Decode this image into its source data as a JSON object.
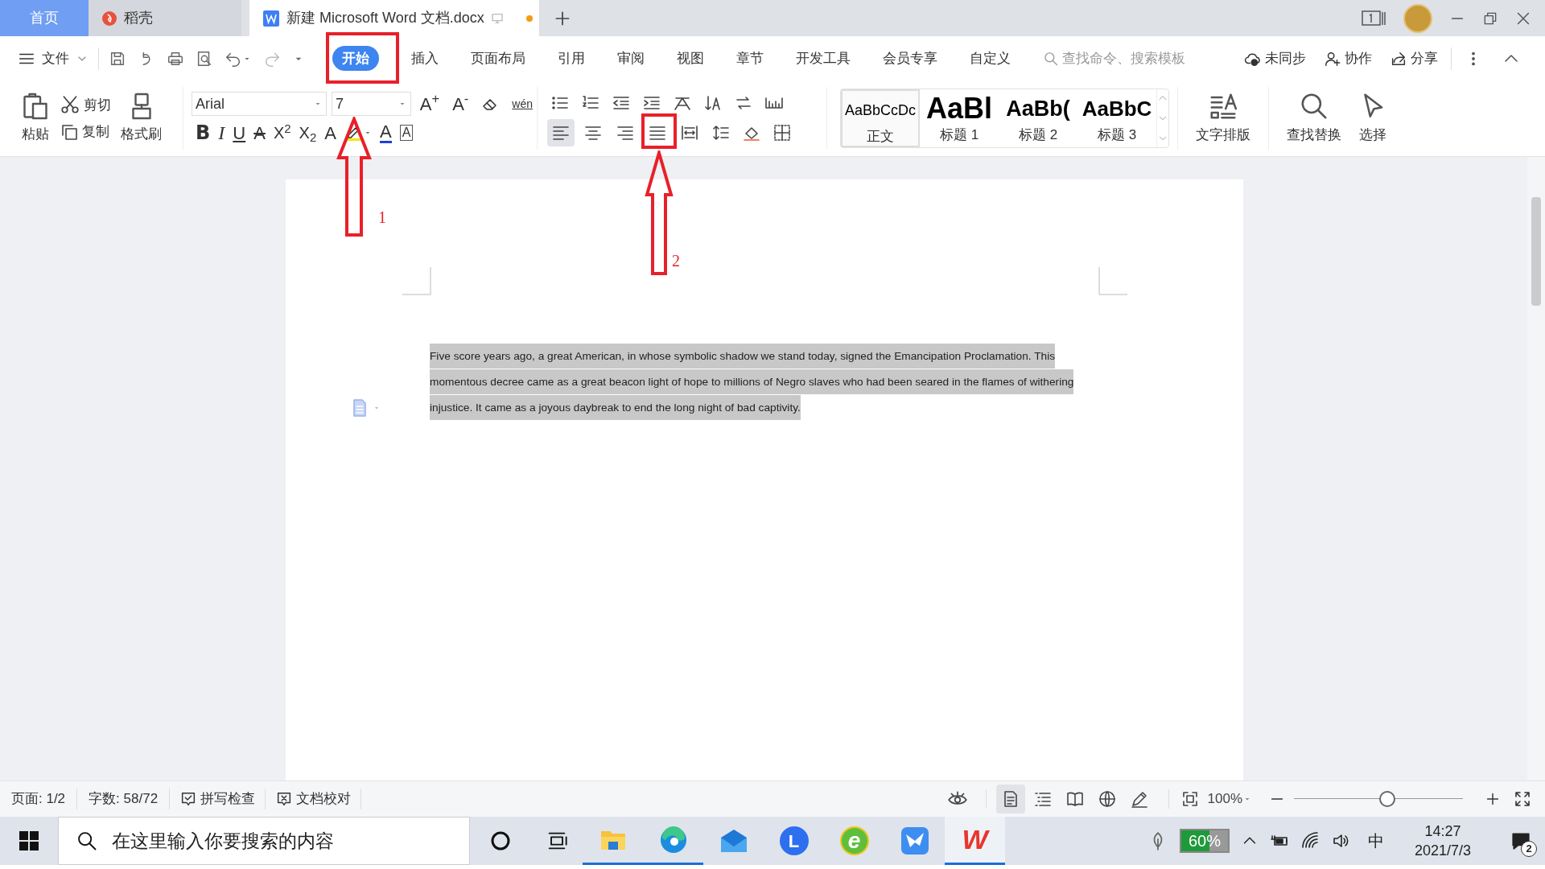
{
  "tabs": [
    {
      "label": "首页",
      "kind": "home",
      "selected": false,
      "unsaved": false
    },
    {
      "label": "稻壳",
      "kind": "docer",
      "selected": false,
      "unsaved": false
    },
    {
      "label": "新建 Microsoft Word 文档.docx",
      "kind": "document",
      "selected": true,
      "unsaved": true
    }
  ],
  "menu": {
    "file": "文件",
    "items": [
      {
        "label": "开始",
        "selected": true
      },
      {
        "label": "插入",
        "selected": false
      },
      {
        "label": "页面布局",
        "selected": false
      },
      {
        "label": "引用",
        "selected": false
      },
      {
        "label": "审阅",
        "selected": false
      },
      {
        "label": "视图",
        "selected": false
      },
      {
        "label": "章节",
        "selected": false
      },
      {
        "label": "开发工具",
        "selected": false
      },
      {
        "label": "会员专享",
        "selected": false
      },
      {
        "label": "自定义",
        "selected": false
      }
    ],
    "search": {
      "placeholder": "查找命令、搜索模板"
    },
    "sync": "未同步",
    "collaborate": "协作",
    "share": "分享"
  },
  "ribbon": {
    "paste": "粘贴",
    "cut": "剪切",
    "copy": "复制",
    "format_painter": "格式刷",
    "font_name": "Arial",
    "font_size": "7",
    "font_buttons_top": [
      {
        "kind": "grow",
        "glyph": "A$^{+}$"
      },
      {
        "kind": "shrink",
        "glyph": "A$^{-}$"
      },
      {
        "kind": "pinyin",
        "glyph": "wén"
      }
    ],
    "font_buttons": [
      {
        "kind": "bold",
        "glyph": "B"
      },
      {
        "kind": "italic",
        "glyph": "I"
      },
      {
        "kind": "underline",
        "glyph": "U"
      },
      {
        "kind": "strike",
        "glyph": "A"
      },
      {
        "kind": "superscript",
        "glyph": "X$^{2}$"
      },
      {
        "kind": "subscript",
        "glyph": "X$_{2}$"
      },
      {
        "kind": "effect",
        "glyph": "A"
      },
      {
        "kind": "highlight"
      },
      {
        "kind": "color",
        "glyph": "A"
      },
      {
        "kind": "border",
        "glyph": "A"
      }
    ],
    "alignments": [
      {
        "kind": "left",
        "selected": true
      },
      {
        "kind": "center",
        "selected": false
      },
      {
        "kind": "right",
        "selected": false
      },
      {
        "kind": "justify",
        "selected": false
      },
      {
        "kind": "distributed",
        "selected": false
      }
    ],
    "styles": [
      {
        "preview": "AaBbCcDc",
        "label": "正文",
        "kind": "body",
        "selected": true
      },
      {
        "preview": "AaBl",
        "label": "标题 1",
        "kind": "h1",
        "selected": false
      },
      {
        "preview": "AaBb(",
        "label": "标题 2",
        "kind": "h2",
        "selected": false
      },
      {
        "preview": "AaBbC",
        "label": "标题 3",
        "kind": "h3",
        "selected": false
      }
    ],
    "text_layout": "文字排版",
    "find_replace": "查找替换",
    "select": "选择"
  },
  "document": {
    "paragraph": "Five score years ago, a great American, in whose symbolic shadow we stand today, signed the Emancipation Proclamation. This momentous decree came as a great beacon light of hope to millions of Negro slaves who had been seared in the flames of withering injustice. It came as a joyous daybreak to end the long night of bad captivity.",
    "selected": true
  },
  "annotations": [
    {
      "label": "1"
    },
    {
      "label": "2"
    }
  ],
  "status_bar": {
    "page": "页面: 1/2",
    "words": "字数: 58/72",
    "spell_check": "拼写检查",
    "proofread": "文档校对",
    "views": [
      {
        "kind": "page",
        "selected": true
      },
      {
        "kind": "outline",
        "selected": false
      },
      {
        "kind": "reading",
        "selected": false
      },
      {
        "kind": "web",
        "selected": false
      },
      {
        "kind": "write",
        "selected": false
      }
    ],
    "zoom": "100%",
    "zoom_slider": {
      "level": 0.55
    }
  },
  "taskbar": {
    "search": {
      "placeholder": "在这里输入你要搜索的内容"
    },
    "apps": [
      {
        "kind": "explorer",
        "running": true
      },
      {
        "kind": "edge",
        "running": true
      },
      {
        "kind": "mail",
        "running": false
      },
      {
        "kind": "lapp",
        "label": "L",
        "running": false
      },
      {
        "kind": "ie",
        "label": "e",
        "running": false
      },
      {
        "kind": "bird",
        "running": false
      },
      {
        "kind": "wps",
        "label": "W",
        "running": true
      }
    ],
    "battery": "60%",
    "ime": "中",
    "time": "14:27",
    "date": "2021/7/3",
    "notifications": "2"
  }
}
